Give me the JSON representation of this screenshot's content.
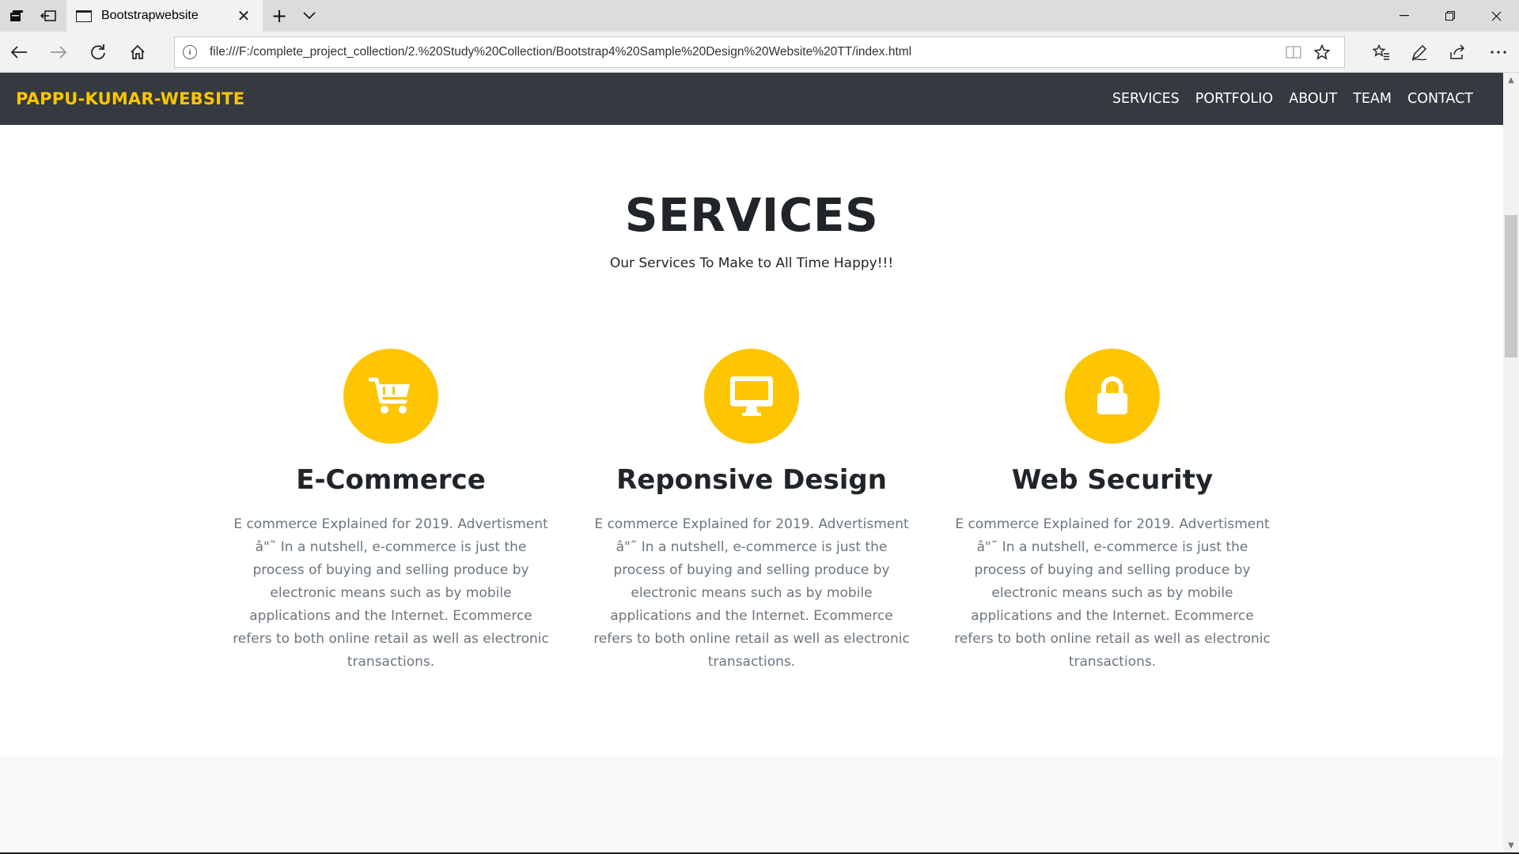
{
  "browser": {
    "tab_title": "Bootstrapwebsite",
    "url": "file:///F:/complete_project_collection/2.%20Study%20Collection/Bootstrap4%20Sample%20Design%20Website%20TT/index.html"
  },
  "site": {
    "brand": "PAPPU-KUMAR-WEBSITE",
    "nav": [
      "SERVICES",
      "PORTFOLIO",
      "ABOUT",
      "TEAM",
      "CONTACT"
    ],
    "services": {
      "heading": "SERVICES",
      "subheading": "Our Services To Make to All Time Happy!!!",
      "items": [
        {
          "icon": "shopping-cart-icon",
          "title": "E-Commerce",
          "text": "E commerce Explained for 2019. Advertisment â\"˜ In a nutshell, e-commerce is just the process of buying and selling produce by electronic means such as by mobile applications and the Internet. Ecommerce refers to both online retail as well as electronic transactions."
        },
        {
          "icon": "desktop-icon",
          "title": "Reponsive Design",
          "text": "E commerce Explained for 2019. Advertisment â\"˜ In a nutshell, e-commerce is just the process of buying and selling produce by electronic means such as by mobile applications and the Internet. Ecommerce refers to both online retail as well as electronic transactions."
        },
        {
          "icon": "lock-icon",
          "title": "Web Security",
          "text": "E commerce Explained for 2019. Advertisment â\"˜ In a nutshell, e-commerce is just the process of buying and selling produce by electronic means such as by mobile applications and the Internet. Ecommerce refers to both online retail as well as electronic transactions."
        }
      ]
    }
  },
  "colors": {
    "accent": "#fec503",
    "navbar": "#343a40",
    "heading": "#212529",
    "muted": "#6c757d"
  }
}
